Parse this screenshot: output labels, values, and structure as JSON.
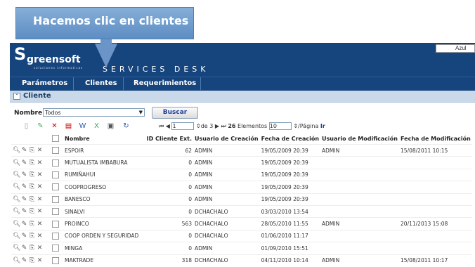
{
  "callout": "Hacemos clic en clientes",
  "theme_label": "Azul",
  "logo": {
    "name": "greensoft",
    "tagline": "soluciones informaticas",
    "product": "SERVICES DESK"
  },
  "menu": [
    "Parámetros",
    "Clientes",
    "Requerimientos"
  ],
  "panel_title": "Cliente",
  "filter": {
    "label": "Nombre",
    "value": "Todos",
    "button": "Buscar"
  },
  "pager": {
    "page": "1",
    "of": "de 3",
    "total": "26",
    "elements_label": "Elementos",
    "per_page": "10",
    "per_page_label": "/Página",
    "go": "Ir"
  },
  "columns": [
    "Nombre",
    "ID Cliente Ext.",
    "Usuario de Creación",
    "Fecha de Creación",
    "Usuario de Modificación",
    "Fecha de Modificación"
  ],
  "rows": [
    [
      "ESPOIR",
      "62",
      "ADMIN",
      "19/05/2009 20:39",
      "ADMIN",
      "15/08/2011 10:15"
    ],
    [
      "MUTUALISTA IMBABURA",
      "0",
      "ADMIN",
      "19/05/2009 20:39",
      "",
      ""
    ],
    [
      "RUMIÑAHUI",
      "0",
      "ADMIN",
      "19/05/2009 20:39",
      "",
      ""
    ],
    [
      "COOPROGRESO",
      "0",
      "ADMIN",
      "19/05/2009 20:39",
      "",
      ""
    ],
    [
      "BANESCO",
      "0",
      "ADMIN",
      "19/05/2009 20:39",
      "",
      ""
    ],
    [
      "SINALVI",
      "0",
      "DCHACHALO",
      "03/03/2010 13:54",
      "",
      ""
    ],
    [
      "PROINCO",
      "563",
      "DCHACHALO",
      "28/05/2010 11:55",
      "ADMIN",
      "20/11/2013 15:08"
    ],
    [
      "COOP ORDEN Y SEGURIDAD",
      "0",
      "DCHACHALO",
      "01/06/2010 11:17",
      "",
      ""
    ],
    [
      "MINGA",
      "0",
      "ADMIN",
      "01/09/2010 15:51",
      "",
      ""
    ],
    [
      "MAKTRADE",
      "318",
      "DCHACHALO",
      "04/11/2010 10:14",
      "ADMIN",
      "15/08/2011 10:17"
    ]
  ]
}
